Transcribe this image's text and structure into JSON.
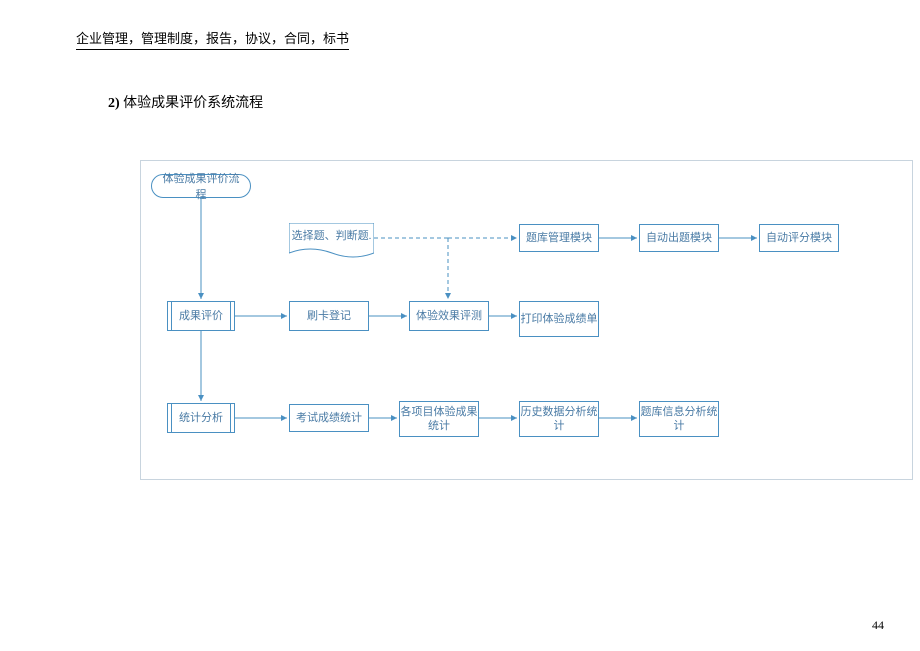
{
  "header": "企业管理，管理制度，报告，协议，合同，标书",
  "section_num": "2)",
  "section_title": "体验成果评价系统流程",
  "page_num": "44",
  "nodes": {
    "start": "体验成果评价流程",
    "doc1": "选择题、判断题.",
    "r1_c1": "成果评价",
    "r1_c2": "刷卡登记",
    "r1_c3": "体验效果评测",
    "r1_c4": "打印体验成绩单",
    "r0_c4": "题库管理模块",
    "r0_c5": "自动出题模块",
    "r0_c6": "自动评分模块",
    "r2_c1": "统计分析",
    "r2_c2": "考试成绩统计",
    "r2_c3": "各项目体验成果统计",
    "r2_c4": "历史数据分析统计",
    "r2_c5": "题库信息分析统计"
  }
}
